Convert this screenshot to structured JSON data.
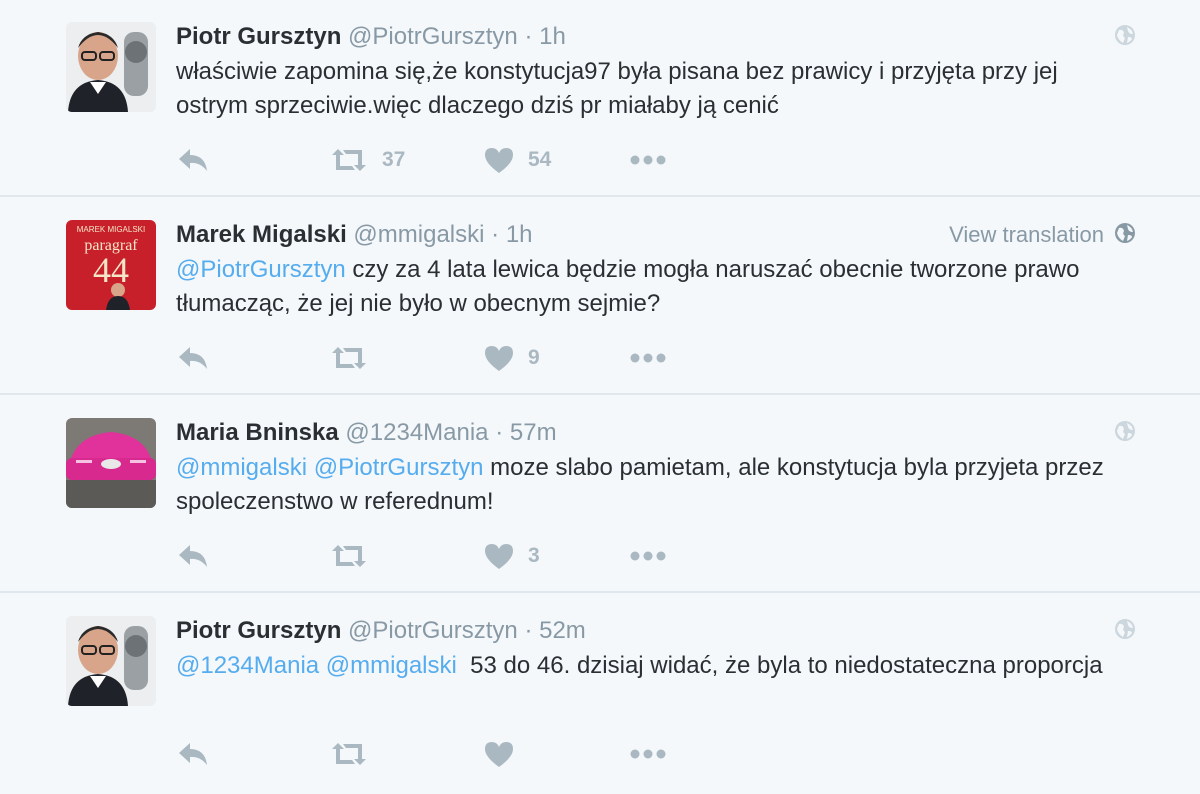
{
  "colors": {
    "accent": "#55acee",
    "icon": "#aab8c2",
    "meta": "#8899a6",
    "text": "#292f33"
  },
  "tweets": [
    {
      "name": "Piotr Gursztyn",
      "handle": "@PiotrGursztyn",
      "sep": "·",
      "time": "1h",
      "mention1": "",
      "mention2": "",
      "body": "właściwie zapomina się,że konstytucja97 była pisana bez prawicy i przyjęta przy jej ostrym sprzeciwie.więc dlaczego dziś pr miałaby ją cenić",
      "retweets": "37",
      "likes": "54"
    },
    {
      "name": "Marek Migalski",
      "handle": "@mmigalski",
      "sep": "·",
      "time": "1h",
      "translation": "View translation",
      "mention1": "@PiotrGursztyn",
      "mention2": "",
      "body": " czy za 4 lata lewica będzie mogła naruszać obecnie tworzone prawo tłumacząc, że jej nie było w obecnym sejmie?",
      "retweets": "",
      "likes": "9",
      "avatar_text_top": "MAREK MIGALSKI",
      "avatar_text_mid": "paragraf",
      "avatar_text_num": "44"
    },
    {
      "name": "Maria Bninska",
      "handle": "@1234Mania",
      "sep": "·",
      "time": "57m",
      "mention1": "@mmigalski",
      "mention2": "@PiotrGursztyn",
      "body": " moze slabo pamietam, ale konstytucja byla przyjeta przez spoleczenstwo w referednum!",
      "retweets": "",
      "likes": "3"
    },
    {
      "name": "Piotr Gursztyn",
      "handle": "@PiotrGursztyn",
      "sep": "·",
      "time": "52m",
      "mention1": "@1234Mania",
      "mention2": "@mmigalski",
      "body": "  53 do 46. dzisiaj widać, że byla to niedostateczna proporcja",
      "retweets": "",
      "likes": ""
    }
  ]
}
